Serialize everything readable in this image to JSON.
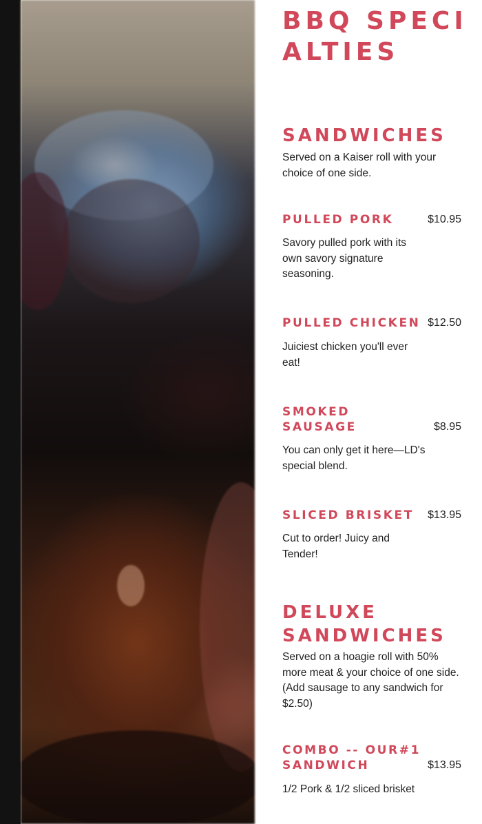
{
  "heading": "BBQ SPECIALTIES",
  "sections": {
    "sandwiches": {
      "title": "SANDWICHES",
      "description": "Served on a Kaiser roll with your choice of one side."
    },
    "deluxe": {
      "title": "DELUXE SANDWICHES",
      "description": "Served on a hoagie roll with 50% more meat & your choice of one side. (Add sausage to any sandwich for $2.50)"
    }
  },
  "items": {
    "pulled_pork": {
      "name": "PULLED PORK",
      "price": "$10.95",
      "description": "Savory pulled pork with its own savory signature seasoning."
    },
    "pulled_chicken": {
      "name": "PULLED CHICKEN",
      "price": "$12.50",
      "description": "Juiciest chicken you'll ever eat!"
    },
    "smoked_sausage": {
      "name": "SMOKED SAUSAGE",
      "price": "$8.95",
      "description": "You can only get it here—LD's special blend."
    },
    "sliced_brisket": {
      "name": "SLICED BRISKET",
      "price": "$13.95",
      "description": "Cut to order! Juicy and Tender!"
    },
    "combo": {
      "name": "COMBO -- OUR#1 SANDWICH",
      "price": "$13.95",
      "description": "1/2 Pork & 1/2 sliced brisket"
    }
  }
}
